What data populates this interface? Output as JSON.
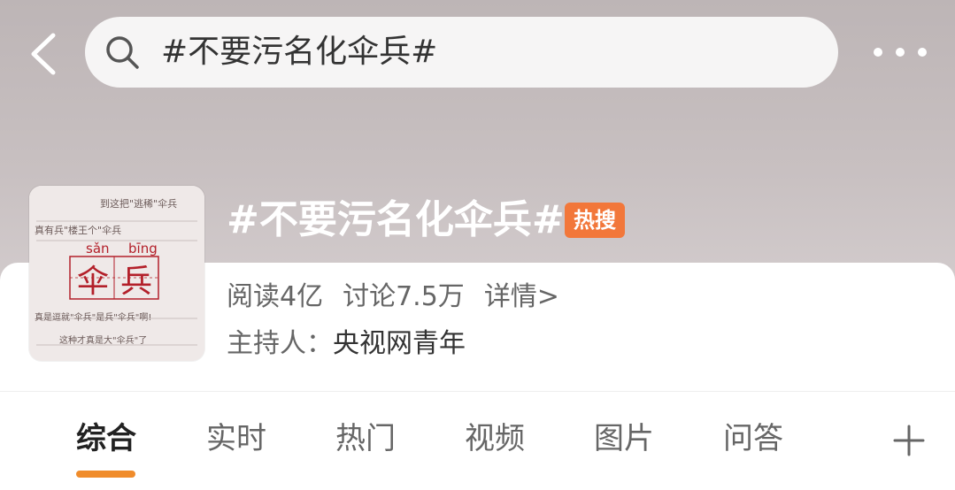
{
  "search": {
    "query": "#不要污名化伞兵#"
  },
  "topic": {
    "title": "#不要污名化伞兵#",
    "badge": "热搜",
    "reads": "阅读4亿",
    "discussions": "讨论7.5万",
    "details": "详情>",
    "host_label": "主持人：",
    "host_value": "央视网青年",
    "thumbnail": {
      "pinyin_1": "sǎn",
      "pinyin_2": "bīng",
      "char_1": "伞",
      "char_2": "兵",
      "note_lines": [
        "到这把\"逃稀\"伞兵",
        "真有兵\"楼王个\"伞兵",
        "真是逗就\"伞兵\"是兵\"伞兵\"啊!",
        "这种才真是大\"伞兵\"了"
      ]
    }
  },
  "tabs": [
    {
      "label": "综合",
      "active": true
    },
    {
      "label": "实时",
      "active": false
    },
    {
      "label": "热门",
      "active": false
    },
    {
      "label": "视频",
      "active": false
    },
    {
      "label": "图片",
      "active": false
    },
    {
      "label": "问答",
      "active": false
    }
  ],
  "colors": {
    "accent": "#f08c2b",
    "badge": "#f2773a",
    "char_red": "#b3202a"
  },
  "icons": {
    "back": "chevron-left-icon",
    "search": "search-icon",
    "more": "more-icon",
    "add_tab": "plus-icon"
  }
}
